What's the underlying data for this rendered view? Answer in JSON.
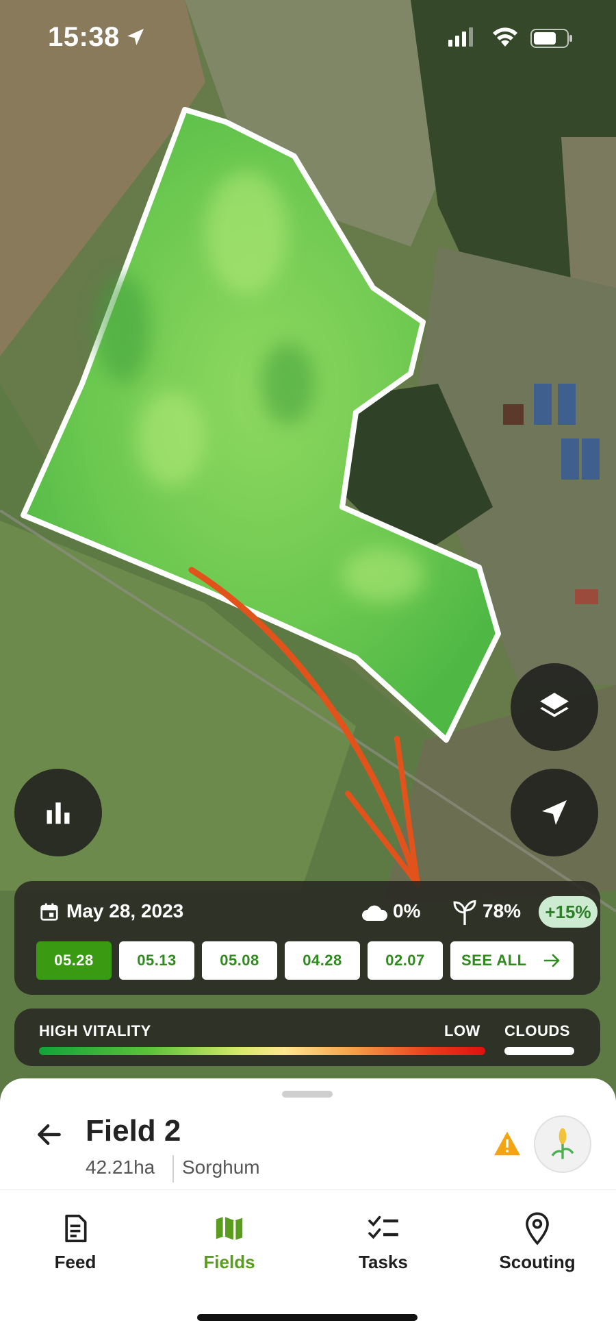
{
  "status_bar": {
    "time": "15:38",
    "icons": [
      "location-arrow-icon",
      "signal-icon",
      "wifi-icon",
      "battery-icon"
    ]
  },
  "map": {
    "field_boundary_color": "#ffffff",
    "annotation_arrow_color": "#e2531b"
  },
  "map_controls": {
    "layers_icon": "layers-icon",
    "locate_icon": "navigation-arrow-icon",
    "stats_icon": "bar-chart-icon"
  },
  "date_panel": {
    "selected_date": "May 28, 2023",
    "cloud_cover": "0%",
    "vegetation": "78%",
    "vegetation_change": "+15%",
    "dates": [
      "05.28",
      "05.13",
      "05.08",
      "04.28",
      "02.07"
    ],
    "see_all_label": "SEE ALL"
  },
  "legend": {
    "high_label": "HIGH VITALITY",
    "low_label": "LOW",
    "clouds_label": "CLOUDS"
  },
  "field": {
    "name": "Field 2",
    "area": "42.21ha",
    "crop": "Sorghum"
  },
  "tabs": [
    {
      "label": "Feed",
      "icon": "document-icon"
    },
    {
      "label": "Fields",
      "icon": "map-icon",
      "active": true
    },
    {
      "label": "Tasks",
      "icon": "checklist-icon"
    },
    {
      "label": "Scouting",
      "icon": "map-pin-icon"
    }
  ],
  "colors": {
    "accent": "#5a9c1d",
    "chip_text": "#2f8a1d",
    "active_chip": "#3a9a12",
    "warning": "#f2a413"
  }
}
